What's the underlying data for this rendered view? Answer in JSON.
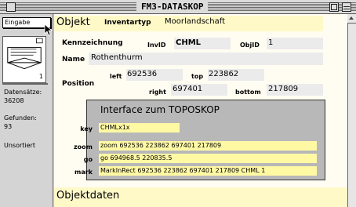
{
  "window": {
    "title": "FM3-DATASKOP"
  },
  "sidebar": {
    "layout_popup": "Eingabe",
    "bookmark_page": "1",
    "records_label": "Datensätze:",
    "records_value": "36208",
    "found_label": "Gefunden:",
    "found_value": "93",
    "sort_status": "Unsortiert"
  },
  "objekt": {
    "heading": "Objekt",
    "inventartyp_label": "Inventartyp",
    "inventartyp_value": "Moorlandschaft",
    "kennzeichnung_label": "Kennzeichnung",
    "invid_label": "InvID",
    "invid_value": "CHML",
    "objid_label": "ObjID",
    "objid_value": "1",
    "name_label": "Name",
    "name_value": "Rothenthurm",
    "position_label": "Position",
    "left_label": "left",
    "left_value": "692536",
    "top_label": "top",
    "top_value": "223862",
    "right_label": "right",
    "right_value": "697401",
    "bottom_label": "bottom",
    "bottom_value": "217809"
  },
  "toposkop": {
    "title": "Interface zum TOPOSKOP",
    "key_label": "key",
    "key_value": "CHMLx1x",
    "zoom_label": "zoom",
    "zoom_value": "zoom 692536 223862 697401 217809",
    "go_label": "go",
    "go_value": "go 694968.5 220835.5",
    "mark_label": "mark",
    "mark_value": "MarkInRect 692536 223862 697401 217809 CHML 1"
  },
  "objektdaten": {
    "heading": "Objektdaten"
  },
  "colors": {
    "field_yellow": "#fff9c8",
    "field_gray": "#ebebeb",
    "toposkop_panel": "#b8b8b8",
    "toposkop_field": "#fff9a4"
  }
}
